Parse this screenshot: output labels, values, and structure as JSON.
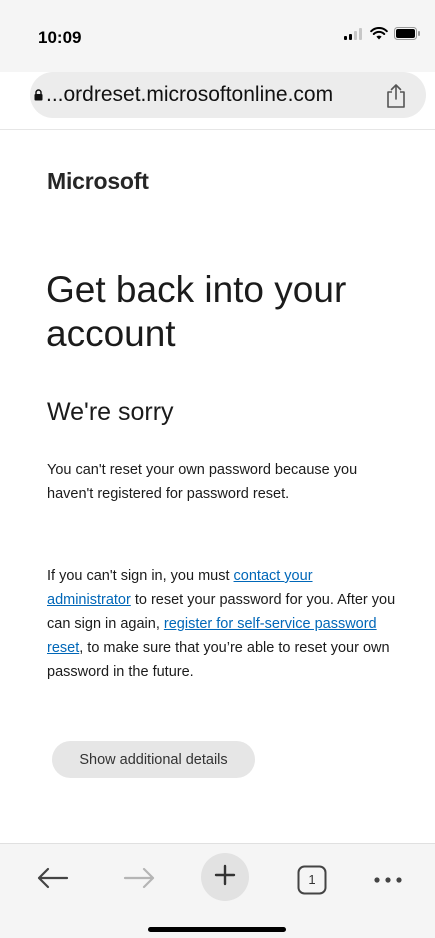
{
  "status_bar": {
    "time": "10:09"
  },
  "browser": {
    "url": "...ordreset.microsoftonline.com",
    "tab_count": "1"
  },
  "page": {
    "brand": "Microsoft",
    "title": "Get back into your account",
    "subtitle": "We're sorry",
    "message": "You can't reset your own password because you haven't registered for password reset.",
    "instructions": {
      "text_1": "If you can't sign in, you must ",
      "link_contact": "contact your administrator",
      "text_2": " to reset your password for you. After you can sign in again, ",
      "link_register": "register for self-service password reset",
      "text_3": ", to make sure that you’re able to reset your own password in the future."
    },
    "details_button": "Show additional details"
  },
  "colors": {
    "link": "#0067b8",
    "button_bg": "#e6e6e6",
    "chrome_bg": "#f5f5f5"
  }
}
